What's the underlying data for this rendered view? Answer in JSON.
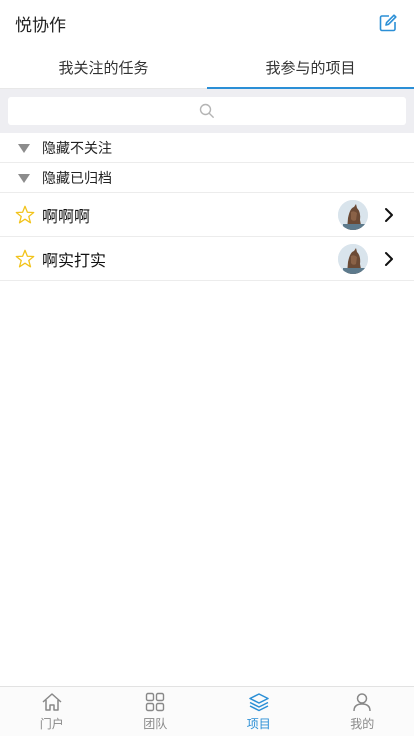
{
  "header": {
    "title": "悦协作",
    "edit_icon": "edit-icon"
  },
  "tabs": [
    {
      "label": "我关注的任务",
      "active": false
    },
    {
      "label": "我参与的项目",
      "active": true
    }
  ],
  "search": {
    "placeholder": "",
    "icon": "search-icon"
  },
  "sections": [
    {
      "label": "隐藏不关注"
    },
    {
      "label": "隐藏已归档"
    }
  ],
  "projects": [
    {
      "name": "啊啊啊",
      "starred": false
    },
    {
      "name": "啊实打实",
      "starred": false
    }
  ],
  "bottom_nav": [
    {
      "label": "门户",
      "icon": "home-icon",
      "active": false
    },
    {
      "label": "团队",
      "icon": "grid-icon",
      "active": false
    },
    {
      "label": "项目",
      "icon": "layers-icon",
      "active": true
    },
    {
      "label": "我的",
      "icon": "user-icon",
      "active": false
    }
  ],
  "colors": {
    "accent": "#2b8fd6",
    "star": "#f2c31b",
    "search_bg": "#eeeef2"
  }
}
